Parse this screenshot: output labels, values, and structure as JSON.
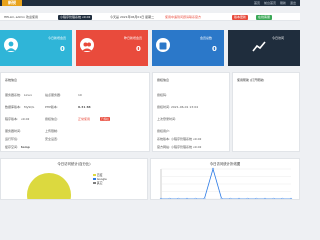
{
  "app": {
    "logo_text": "新锐",
    "colors": {
      "dark": "#1f2d3d",
      "accent": "#e8a21a"
    }
  },
  "topnav": {
    "items": [
      "首页",
      "前台首页",
      "刷新",
      "退出"
    ]
  },
  "notice": {
    "greeting": "HELLO, admin 欢迎使用",
    "version_pill": "小程序管理系统 v9.02",
    "time_text": "今天是 2021年06月01日 星期二",
    "link_red": "使用中遇到问题请联系官方",
    "pill_red": "版本更新",
    "pill_green": "在线客服"
  },
  "stat_cards": [
    {
      "label": "今日新增会员",
      "value": "0",
      "color": "#2fb5d8",
      "icon": "user-icon"
    },
    {
      "label": "昨日新增会员",
      "value": "0",
      "color": "#e94b3c",
      "icon": "user-group-icon"
    },
    {
      "label": "会员总数",
      "value": "0",
      "color": "#2b78c9",
      "icon": "users-icon"
    },
    {
      "label": "今日访问",
      "value": "",
      "color": "#1f2d3d",
      "icon": "chart-icon"
    }
  ],
  "panel_left": {
    "title": "系统信息",
    "rows": [
      {
        "k": "服务器系统:",
        "v": "Linux",
        "k2": "站点服务器:",
        "v2": "10",
        "tag": ""
      },
      {
        "k": "数据库版本:",
        "v": "MySQL",
        "k2": "PHP版本:",
        "v2": "8.31 88",
        "tag": ""
      },
      {
        "k": "程序版本:",
        "v": "v9.02",
        "k2": "授权信息:",
        "v2": "正常使用",
        "tag": "已授权"
      },
      {
        "k": "服务器时间:",
        "v": "",
        "k2": "上传限制:",
        "v2": "",
        "tag": ""
      },
      {
        "k": "运行环境:",
        "v": "",
        "k2": "安全设置:",
        "v2": "",
        "tag": ""
      },
      {
        "k": "缓存空间:",
        "v": "temp",
        "k2": "",
        "v2": "",
        "tag": ""
      }
    ]
  },
  "panel_mid": {
    "title": "授权信息",
    "rows": [
      {
        "k": "授权码:",
        "v": ""
      },
      {
        "k": "授权时间:",
        "v": "2021-06-01 13:04"
      },
      {
        "k": "上次登录时间:",
        "v": ""
      },
      {
        "k": "授权用户:",
        "v": ""
      },
      {
        "k": "系统版本:",
        "v": "小程序管理系统 v9.02"
      },
      {
        "k": "官方网站:",
        "v": "小程序管理系统 v9.02"
      }
    ]
  },
  "panel_right": {
    "title": "使用帮助 (打开帮助)"
  },
  "chart_left": {
    "title": "今日访问统计(百分比)",
    "legend": [
      "百度",
      "Google",
      "其它"
    ]
  },
  "chart_right": {
    "title": "今日访问统计折线图"
  },
  "chart_data": [
    {
      "type": "pie",
      "title": "今日访问统计(百分比)",
      "categories": [
        "百度",
        "Google",
        "其它"
      ],
      "values": [
        100,
        0,
        0
      ],
      "colors": [
        "#dcd93f",
        "#2d7be5",
        "#7d7d7d"
      ]
    },
    {
      "type": "line",
      "title": "今日访问统计折线图",
      "x": [
        0,
        1,
        2,
        3,
        4,
        5,
        6,
        7,
        8,
        9,
        10,
        11,
        12,
        13,
        14,
        15
      ],
      "series": [
        {
          "values": [
            0,
            0,
            0,
            0,
            0,
            0,
            1,
            0,
            0,
            0,
            0,
            0,
            0,
            0,
            0,
            0
          ]
        }
      ],
      "ylim": [
        0,
        1
      ]
    }
  ]
}
